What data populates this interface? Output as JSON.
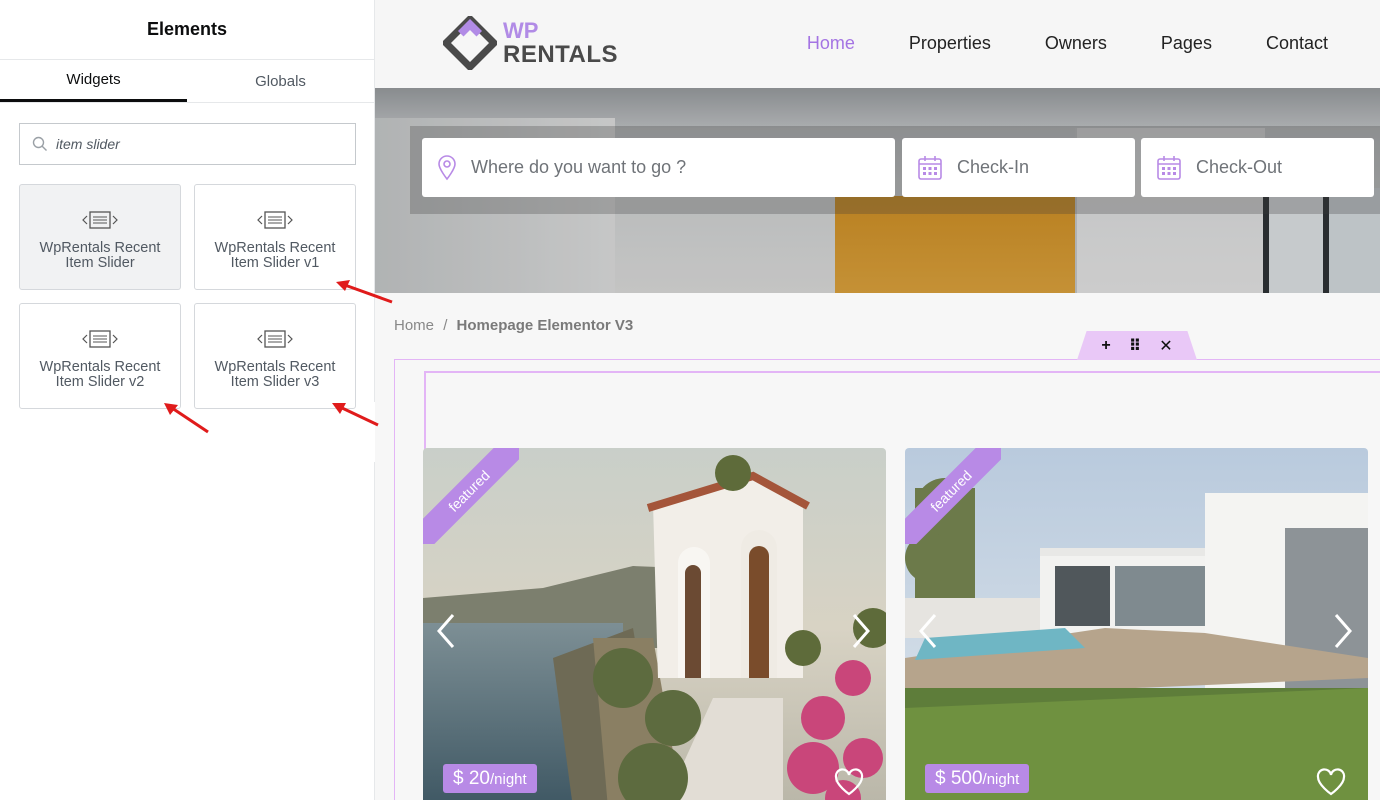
{
  "panel": {
    "title": "Elements",
    "tabs": [
      "Widgets",
      "Globals"
    ],
    "search": {
      "value": "item slider",
      "icon": "search-icon"
    },
    "widgets": [
      {
        "label": "WpRentals Recent Item Slider",
        "icon": "code-slider-icon"
      },
      {
        "label": "WpRentals Recent Item Slider v1",
        "icon": "code-slider-icon"
      },
      {
        "label": "WpRentals Recent Item Slider v2",
        "icon": "code-slider-icon"
      },
      {
        "label": "WpRentals Recent Item Slider v3",
        "icon": "code-slider-icon"
      }
    ],
    "collapse_glyph": "‹"
  },
  "site": {
    "logo": {
      "line1": "WP",
      "line2": "RENTALS"
    },
    "nav": [
      "Home",
      "Properties",
      "Owners",
      "Pages",
      "Contact"
    ],
    "search": {
      "location_placeholder": "Where do you want to go ?",
      "checkin_placeholder": "Check-In",
      "checkout_placeholder": "Check-Out"
    },
    "breadcrumb": {
      "home": "Home",
      "sep": "/",
      "current": "Homepage Elementor V3"
    },
    "toolbar": {
      "add": "+",
      "move": "⠿",
      "close": "✕"
    },
    "cards": [
      {
        "ribbon": "featured",
        "price": "$ 20",
        "unit": "/night"
      },
      {
        "ribbon": "featured",
        "price": "$ 500",
        "unit": "/night"
      }
    ]
  },
  "colors": {
    "accent": "#a474e3",
    "ribbon": "#b88ae6",
    "annotation_arrow": "#e01b1b"
  }
}
